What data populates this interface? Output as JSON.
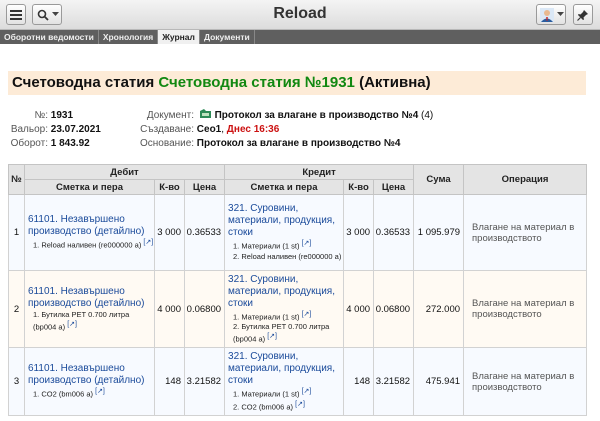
{
  "window": {
    "title": "Reload"
  },
  "tabs": [
    {
      "label": "Оборотни ведомости",
      "active": false
    },
    {
      "label": "Хронология",
      "active": false
    },
    {
      "label": "Журнал",
      "active": true
    },
    {
      "label": "Документи",
      "active": false
    }
  ],
  "heading": {
    "prefix": "Счетоводна статия",
    "name": "Счетоводна статия №1931",
    "state": "(Активна)"
  },
  "info": {
    "number_label": "№:",
    "number": "1931",
    "valeur_label": "Вальор:",
    "valeur": "23.07.2021",
    "turnover_label": "Оборот:",
    "turnover": "1 843.92",
    "document_label": "Документ:",
    "document": "Протокол за влагане в производство №4",
    "document_count": "(4)",
    "created_label": "Създаване:",
    "created_by": "Сео1",
    "created_sep": ",",
    "created_when": "Днес 16:36",
    "basis_label": "Основание:",
    "basis": "Протокол за влагане в производство №4"
  },
  "table": {
    "h_no": "№",
    "h_debit": "Дебит",
    "h_credit": "Кредит",
    "h_sum": "Сума",
    "h_operation": "Операция",
    "h_account": "Сметка и пера",
    "h_qty": "К-во",
    "h_price": "Цена",
    "ext_glyph": "[↗]",
    "rows": [
      {
        "no": "1",
        "debit_account": "61101. Незавършено производство (детайлно)",
        "debit_items": [
          "1. Reload наливен (re000000 a)"
        ],
        "debit_qty": "3 000",
        "debit_price": "0.36533",
        "credit_account": "321. Суровини, материали, продукция, стоки",
        "credit_items": [
          "1. Материали (1 st)",
          "2. Reload наливен (re000000 a)"
        ],
        "credit_qty": "3 000",
        "credit_price": "0.36533",
        "sum": "1 095.979",
        "operation": "Влагане на материал в производството"
      },
      {
        "no": "2",
        "debit_account": "61101. Незавършено производство (детайлно)",
        "debit_items": [
          "1. Бутилка PET 0.700 литра (bp004 a)"
        ],
        "debit_qty": "4 000",
        "debit_price": "0.06800",
        "credit_account": "321. Суровини, материали, продукция, стоки",
        "credit_items": [
          "1. Материали (1 st)",
          "2. Бутилка PET 0.700 литра (bp004 a)"
        ],
        "credit_qty": "4 000",
        "credit_price": "0.06800",
        "sum": "272.000",
        "operation": "Влагане на материал в производството"
      },
      {
        "no": "3",
        "debit_account": "61101. Незавършено производство (детайлно)",
        "debit_items": [
          "1. CO2 (bm006 a)"
        ],
        "debit_qty": "148",
        "debit_price": "3.21582",
        "credit_account": "321. Суровини, материали, продукция, стоки",
        "credit_items": [
          "1. Материали (1 st)",
          "2. CO2 (bm006 a)"
        ],
        "credit_qty": "148",
        "credit_price": "3.21582",
        "sum": "475.941",
        "operation": "Влагане на материал в производството"
      }
    ]
  }
}
